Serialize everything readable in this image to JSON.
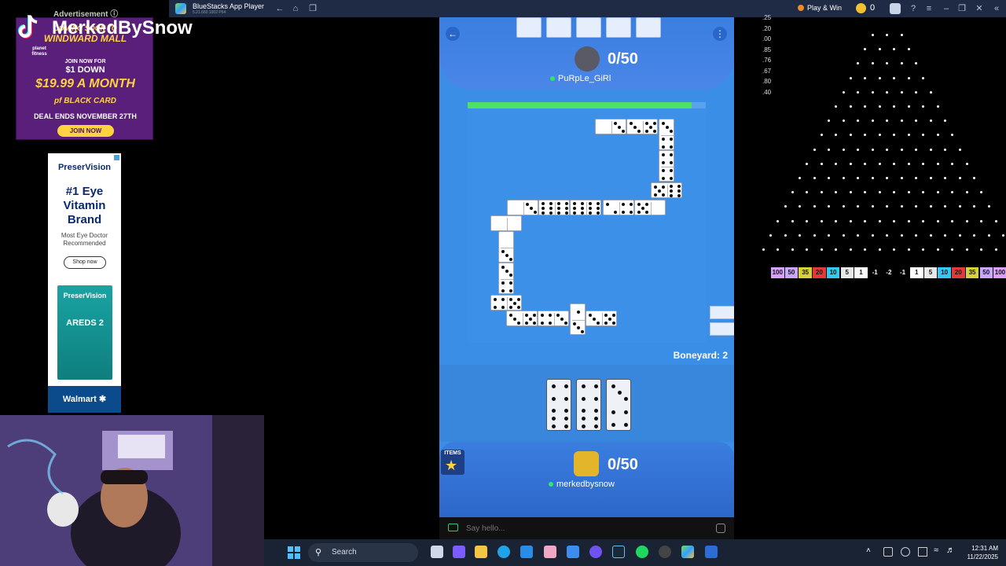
{
  "titlebar": {
    "app_title": "BlueStacks App Player",
    "app_sub": "5.21.660.1002  P64",
    "play_win": "Play & Win",
    "coins": "0"
  },
  "stream": {
    "channel": "MerkedBySnow"
  },
  "ads": {
    "label": "Advertisement",
    "ad1": {
      "brand": "planet fitness",
      "line1": "COMING SOON TO",
      "line2": "WINDWARD MALL",
      "line3": "JOIN NOW FOR",
      "line4": "$1 DOWN",
      "line5": "$19.99 A MONTH",
      "line6": "pf BLACK CARD",
      "line7": "DEAL ENDS NOVEMBER 27TH",
      "button": "JOIN NOW"
    },
    "ad2": {
      "brand": "PreserVision",
      "headline": "#1 Eye Vitamin Brand",
      "sub": "Most Eye Doctor Recommended",
      "button": "Shop now",
      "product_brand": "PreserVision",
      "product_name": "AREDS 2",
      "retailer": "Walmart"
    }
  },
  "game": {
    "opponent": {
      "score": "0/50",
      "name": "PuRpLe_GiRl"
    },
    "player": {
      "score": "0/50",
      "name": "merkedbysnow"
    },
    "progress": 0.94,
    "boneyard": "Boneyard: 2",
    "items_label": "ITEMS",
    "chat_placeholder": "Say hello..."
  },
  "taskbar": {
    "search": "Search",
    "time": "12:31 AM",
    "date": "11/22/2025"
  },
  "plinko": {
    "slots": [
      "100",
      "50",
      "35",
      "20",
      "10",
      "5",
      "1",
      "-1",
      "-2",
      "-1",
      "1",
      "5",
      "10",
      "20",
      "35",
      "50",
      "100"
    ],
    "slot_colors": [
      "#d9a0ff",
      "#c9a6ff",
      "#d8d23a",
      "#e23a3a",
      "#35c8f0",
      "#e8e8e8",
      "#ffffff",
      "#000000",
      "#000000",
      "#000000",
      "#ffffff",
      "#e8e8e8",
      "#35c8f0",
      "#e23a3a",
      "#d8d23a",
      "#c9a6ff",
      "#d9a0ff"
    ],
    "multipliers": [
      ".25",
      ".20",
      ".00",
      ".85",
      ".76",
      ".67",
      ".80",
      ".40"
    ]
  }
}
